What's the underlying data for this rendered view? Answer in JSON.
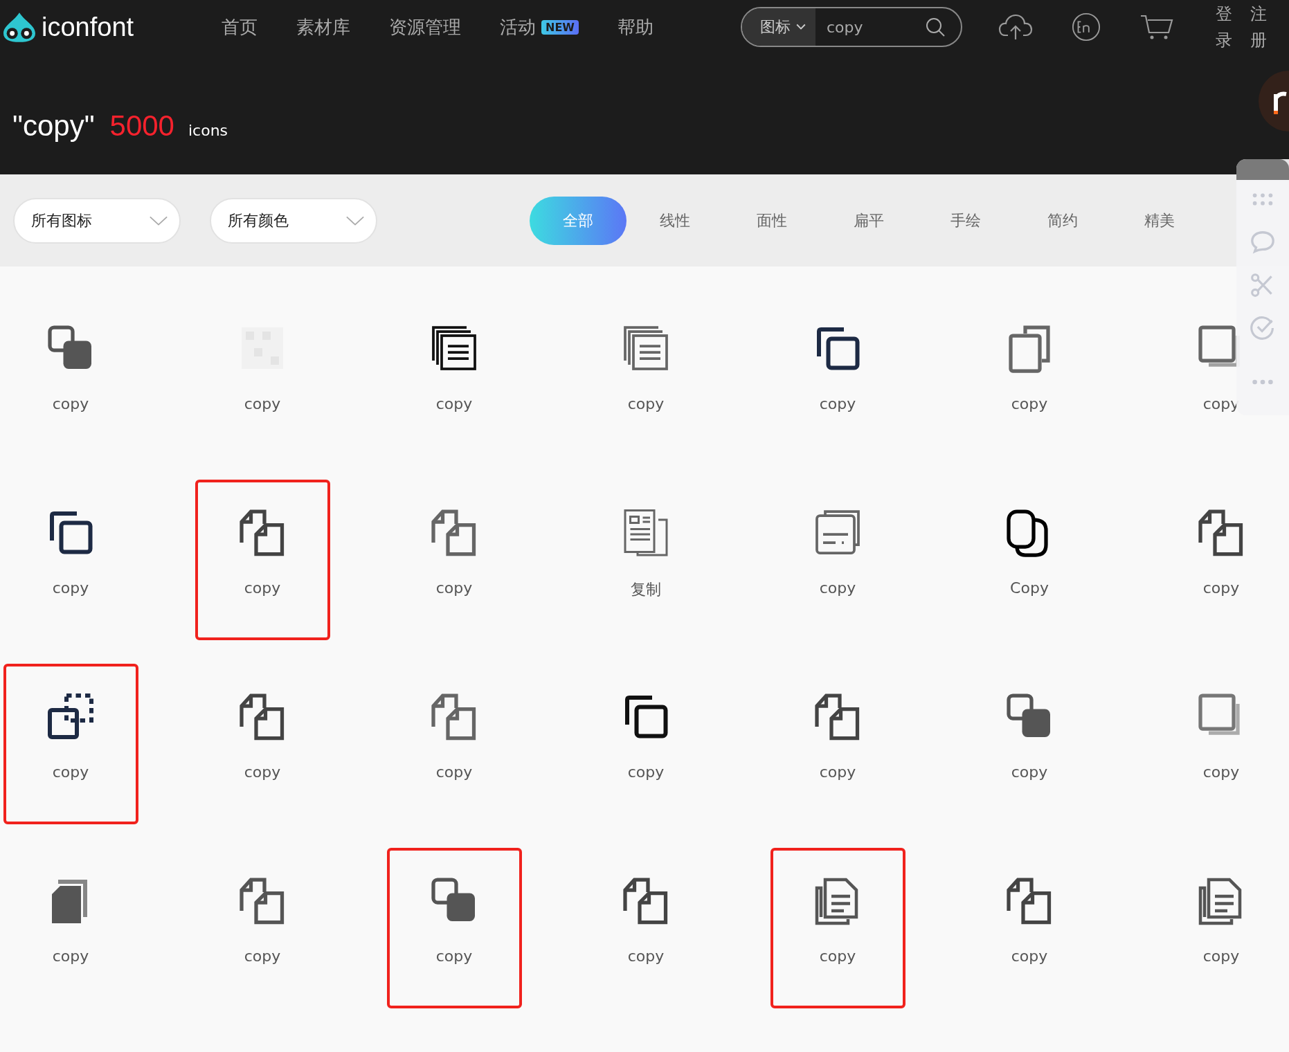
{
  "header": {
    "logo": "iconfont",
    "nav": [
      {
        "label": "首页"
      },
      {
        "label": "素材库"
      },
      {
        "label": "资源管理"
      },
      {
        "label": "活动",
        "badge": "NEW"
      },
      {
        "label": "帮助"
      }
    ],
    "search": {
      "type": "图标",
      "value": "copy"
    },
    "auth": {
      "login": "登录",
      "register": "注册"
    }
  },
  "results": {
    "query": "\"copy\"",
    "count": "5000",
    "unit": "icons"
  },
  "filters": {
    "dropdowns": [
      "所有图标",
      "所有颜色"
    ],
    "tabs": [
      {
        "label": "全部",
        "selected": true
      },
      {
        "label": "线性",
        "selected": false
      },
      {
        "label": "面性",
        "selected": false
      },
      {
        "label": "扁平",
        "selected": false
      },
      {
        "label": "手绘",
        "selected": false
      },
      {
        "label": "简约",
        "selected": false
      },
      {
        "label": "精美",
        "selected": false
      }
    ]
  },
  "icons": [
    {
      "label": "copy",
      "highlighted": false
    },
    {
      "label": "copy",
      "highlighted": false
    },
    {
      "label": "copy",
      "highlighted": false
    },
    {
      "label": "copy",
      "highlighted": false
    },
    {
      "label": "copy",
      "highlighted": false
    },
    {
      "label": "copy",
      "highlighted": false
    },
    {
      "label": "copy",
      "highlighted": false
    },
    {
      "label": "copy",
      "highlighted": false
    },
    {
      "label": "copy",
      "highlighted": true
    },
    {
      "label": "copy",
      "highlighted": false
    },
    {
      "label": "复制",
      "highlighted": false
    },
    {
      "label": "copy",
      "highlighted": false
    },
    {
      "label": "Copy",
      "highlighted": false
    },
    {
      "label": "copy",
      "highlighted": false
    },
    {
      "label": "copy",
      "highlighted": true
    },
    {
      "label": "copy",
      "highlighted": false
    },
    {
      "label": "copy",
      "highlighted": false
    },
    {
      "label": "copy",
      "highlighted": false
    },
    {
      "label": "copy",
      "highlighted": false
    },
    {
      "label": "copy",
      "highlighted": false
    },
    {
      "label": "copy",
      "highlighted": false
    },
    {
      "label": "copy",
      "highlighted": false
    },
    {
      "label": "copy",
      "highlighted": false
    },
    {
      "label": "copy",
      "highlighted": true
    },
    {
      "label": "copy",
      "highlighted": false
    },
    {
      "label": "copy",
      "highlighted": true
    },
    {
      "label": "copy",
      "highlighted": false
    },
    {
      "label": "copy",
      "highlighted": false
    }
  ]
}
